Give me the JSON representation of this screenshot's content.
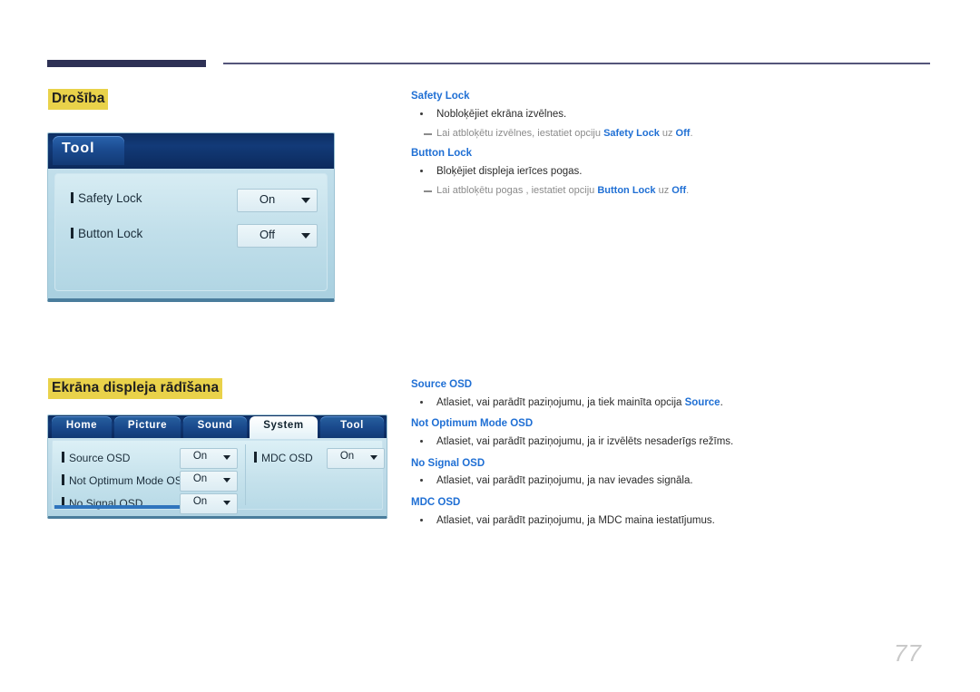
{
  "page": {
    "number": "77"
  },
  "sections": [
    {
      "heading": "Drošība",
      "osd": {
        "kind": "tool-panel",
        "tab_label": "Tool",
        "rows": [
          {
            "label": "Safety Lock",
            "value": "On"
          },
          {
            "label": "Button Lock",
            "value": "Off"
          }
        ]
      },
      "text_blocks": [
        {
          "term": "Safety Lock",
          "bullet": "Nobloķējiet ekrāna izvēlnes.",
          "note_pre": "Lai atbloķētu izvēlnes, iestatiet opciju ",
          "note_kw1": "Safety Lock",
          "note_mid": " uz ",
          "note_kw2": "Off",
          "note_post": "."
        },
        {
          "term": "Button Lock",
          "bullet": "Bloķējiet displeja ierīces pogas.",
          "note_pre": "Lai atbloķētu pogas , iestatiet opciju ",
          "note_kw1": "Button Lock",
          "note_mid": " uz ",
          "note_kw2": "Off",
          "note_post": "."
        }
      ]
    },
    {
      "heading": "Ekrāna displeja rādīšana",
      "osd": {
        "kind": "system-panel",
        "tabs": [
          {
            "label": "Home",
            "active": false
          },
          {
            "label": "Picture",
            "active": false
          },
          {
            "label": "Sound",
            "active": false
          },
          {
            "label": "System",
            "active": true
          },
          {
            "label": "Tool",
            "active": false
          }
        ],
        "rows_left": [
          {
            "label": "Source OSD",
            "value": "On"
          },
          {
            "label": "Not Optimum Mode OSD",
            "value": "On"
          },
          {
            "label": "No Signal OSD",
            "value": "On"
          }
        ],
        "rows_right": [
          {
            "label": "MDC OSD",
            "value": "On"
          }
        ]
      },
      "text_blocks": [
        {
          "term": "Source OSD",
          "bullet_pre": "Atlasiet, vai parādīt paziņojumu, ja tiek mainīta opcija ",
          "bullet_kw": "Source",
          "bullet_post": "."
        },
        {
          "term": "Not Optimum Mode OSD",
          "bullet_pre": "Atlasiet, vai parādīt paziņojumu, ja ir izvēlēts nesaderīgs režīms.",
          "bullet_kw": "",
          "bullet_post": ""
        },
        {
          "term": "No Signal OSD",
          "bullet_pre": "Atlasiet, vai parādīt paziņojumu, ja nav ievades signāla.",
          "bullet_kw": "",
          "bullet_post": ""
        },
        {
          "term": "MDC OSD",
          "bullet_pre": "Atlasiet, vai parādīt paziņojumu, ja MDC maina iestatījumus.",
          "bullet_kw": "",
          "bullet_post": ""
        }
      ]
    }
  ],
  "colors": {
    "heading_highlight": "#e9d24a",
    "term_blue": "#1f6fd4",
    "rule_navy": "#2e3155",
    "rule_thin": "#54557a",
    "page_number": "#c9c9c9"
  }
}
